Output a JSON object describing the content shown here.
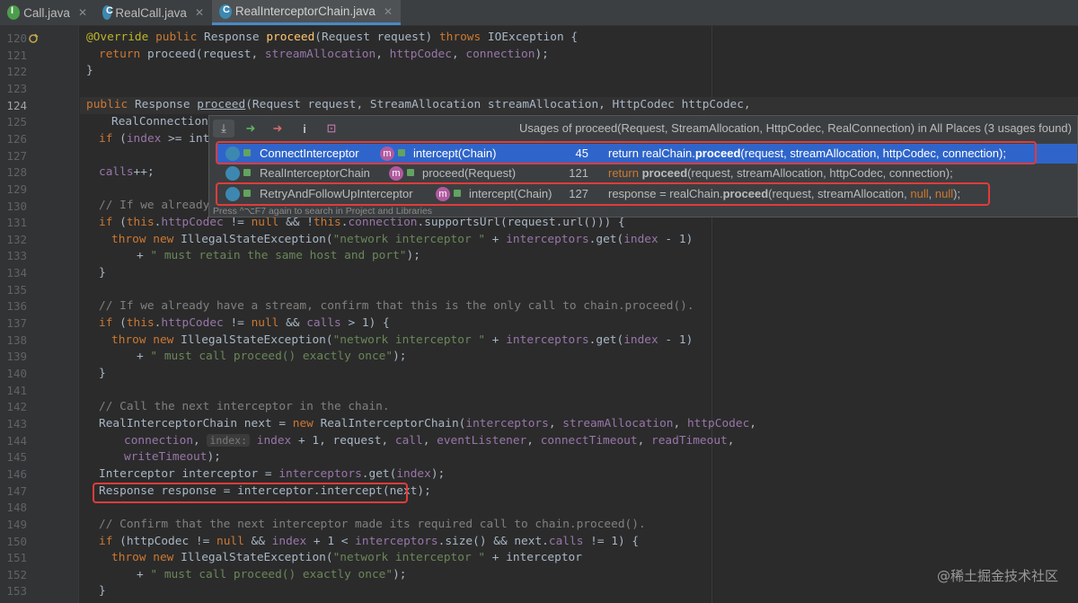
{
  "tabs": [
    {
      "label": "Call.java",
      "icon": "interface-icon"
    },
    {
      "label": "RealCall.java",
      "icon": "class-icon"
    },
    {
      "label": "RealInterceptorChain.java",
      "icon": "class-icon",
      "active": true
    }
  ],
  "line_numbers": [
    "120",
    "121",
    "122",
    "123",
    "124",
    "125",
    "126",
    "127",
    "128",
    "129",
    "130",
    "131",
    "132",
    "133",
    "134",
    "135",
    "136",
    "137",
    "138",
    "139",
    "140",
    "141",
    "142",
    "143",
    "144",
    "145",
    "146",
    "147",
    "148",
    "149",
    "150",
    "151",
    "152",
    "153"
  ],
  "current_line": "124",
  "code": {
    "l120": {
      "ann": "@Override",
      "kw1": "public",
      "t1": " Response ",
      "fn": "proceed",
      "t2": "(Request request) ",
      "kw2": "throws",
      "t3": " IOException {"
    },
    "l121": {
      "kw": "return",
      "t1": " proceed(request, ",
      "f1": "streamAllocation",
      "t2": ", ",
      "f2": "httpCodec",
      "t3": ", ",
      "f3": "connection",
      "t4": ");"
    },
    "l122": {
      "t": "}"
    },
    "l124": {
      "kw": "public",
      "t1": " Response ",
      "fn": "proceed",
      "t2": "(Request request, StreamAllocation streamAllocation, HttpCodec httpCodec,"
    },
    "l125": {
      "t": "RealConnection"
    },
    "l126": {
      "kw": "if",
      "t1": " (",
      "f1": "index",
      "t2": " >= inte"
    },
    "l128": {
      "f": "calls",
      "t": "++;"
    },
    "l130": {
      "c": "// If we already"
    },
    "l131": {
      "kw": "if",
      "t1": " (",
      "kw2": "this",
      "t2": ".",
      "f1": "httpCodec",
      "t3": " != ",
      "kw3": "null",
      "t4": " && !",
      "kw4": "this",
      "t5": ".",
      "f2": "connection",
      "t6": ".supportsUrl(request.url())) {"
    },
    "l132": {
      "kw": "throw",
      "t1": " ",
      "kw2": "new",
      "t2": " IllegalStateException(",
      "s": "\"network interceptor \"",
      "t3": " + ",
      "f": "interceptors",
      "t4": ".get(",
      "f2": "index",
      "t5": " - ",
      "n": "1",
      "t6": ")"
    },
    "l133": {
      "t1": "+ ",
      "s": "\" must retain the same host and port\"",
      "t2": ");"
    },
    "l134": {
      "t": "}"
    },
    "l136": {
      "c": "// If we already have a stream, confirm that this is the only call to chain.proceed()."
    },
    "l137": {
      "kw": "if",
      "t1": " (",
      "kw2": "this",
      "t2": ".",
      "f1": "httpCodec",
      "t3": " != ",
      "kw3": "null",
      "t4": " && ",
      "f2": "calls",
      "t5": " > ",
      "n": "1",
      "t6": ") {"
    },
    "l138": {
      "kw": "throw",
      "t1": " ",
      "kw2": "new",
      "t2": " IllegalStateException(",
      "s": "\"network interceptor \"",
      "t3": " + ",
      "f": "interceptors",
      "t4": ".get(",
      "f2": "index",
      "t5": " - ",
      "n": "1",
      "t6": ")"
    },
    "l139": {
      "t1": "+ ",
      "s": "\" must call proceed() exactly once\"",
      "t2": ");"
    },
    "l140": {
      "t": "}"
    },
    "l142": {
      "c": "// Call the next interceptor in the chain."
    },
    "l143": {
      "t1": "RealInterceptorChain next = ",
      "kw": "new",
      "t2": " RealInterceptorChain(",
      "f1": "interceptors",
      "t3": ", ",
      "f2": "streamAllocation",
      "t4": ", ",
      "f3": "httpCodec",
      "t5": ","
    },
    "l144": {
      "f1": "connection",
      "t1": ", ",
      "hint": "index:",
      "t2": " ",
      "f2": "index",
      "t3": " + ",
      "n": "1",
      "t4": ", request, ",
      "f3": "call",
      "t5": ", ",
      "f4": "eventListener",
      "t6": ", ",
      "f5": "connectTimeout",
      "t7": ", ",
      "f6": "readTimeout",
      "t8": ","
    },
    "l145": {
      "f": "writeTimeout",
      "t": ");"
    },
    "l146": {
      "t1": "Interceptor interceptor = ",
      "f": "interceptors",
      "t2": ".get(",
      "f2": "index",
      "t3": ");"
    },
    "l147": {
      "t": "Response response = interceptor.intercept(next);"
    },
    "l149": {
      "c": "// Confirm that the next interceptor made its required call to chain.proceed()."
    },
    "l150": {
      "kw": "if",
      "t1": " (httpCodec != ",
      "kw2": "null",
      "t2": " && ",
      "f1": "index",
      "t3": " + ",
      "n": "1",
      "t4": " < ",
      "f2": "interceptors",
      "t5": ".size() && next.",
      "f3": "calls",
      "t6": " != ",
      "n2": "1",
      "t7": ") {"
    },
    "l151": {
      "kw": "throw",
      "t1": " ",
      "kw2": "new",
      "t2": " IllegalStateException(",
      "s": "\"network interceptor \"",
      "t3": " + interceptor"
    },
    "l152": {
      "t1": "+ ",
      "s": "\" must call proceed() exactly once\"",
      "t2": ");"
    },
    "l153": {
      "t": "}"
    }
  },
  "popup": {
    "title": "Usages of proceed(Request, StreamAllocation, HttpCodec, RealConnection) in All Places (3 usages found)",
    "footer": "Press ^⌥F7 again to search in Project and Libraries",
    "rows": [
      {
        "cls": "ConnectInterceptor",
        "method": "intercept(Chain)",
        "line": "45",
        "c1": "return realChain.",
        "c2": "proceed",
        "c3": "(request, streamAllocation, httpCodec, connection);",
        "selected": true
      },
      {
        "cls": "RealInterceptorChain",
        "method": "proceed(Request)",
        "line": "121",
        "c1": "return ",
        "c2": "proceed",
        "c3": "(request, streamAllocation, httpCodec, connection);"
      },
      {
        "cls": "RetryAndFollowUpInterceptor",
        "method": "intercept(Chain)",
        "line": "127",
        "c1": "response = realChain.",
        "c2": "proceed",
        "c3": "(request, streamAllocation, ",
        "c4": "null",
        "c5": ", ",
        "c6": "null",
        "c7": ");"
      }
    ]
  },
  "watermark": "@稀土掘金技术社区",
  "colors": {
    "selection": "#2f65ca",
    "highlight_box": "#e03c3c",
    "keyword": "#cc7832",
    "string": "#6a8759",
    "field": "#9876aa",
    "method": "#ffc66d"
  }
}
